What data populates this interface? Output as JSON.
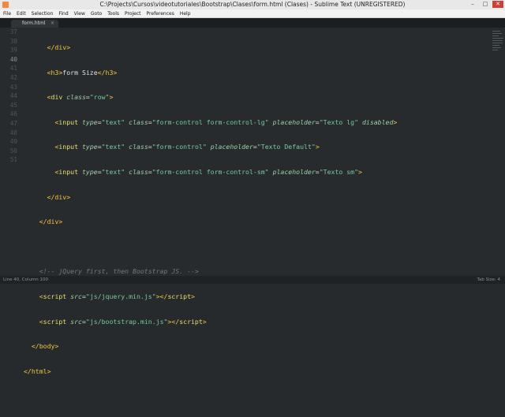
{
  "window": {
    "title": "C:\\Projects\\Cursos\\videotutoriales\\Bootstrap\\Clases\\form.html (Clases) - Sublime Text (UNREGISTERED)"
  },
  "menu": [
    "File",
    "Edit",
    "Selection",
    "Find",
    "View",
    "Goto",
    "Tools",
    "Project",
    "Preferences",
    "Help"
  ],
  "tab": {
    "label": "form.html",
    "close": "×"
  },
  "gutter": [
    "37",
    "38",
    "39",
    "40",
    "41",
    "42",
    "43",
    "44",
    "45",
    "46",
    "47",
    "48",
    "49",
    "50",
    "51"
  ],
  "code": {
    "l1_close_div": "</div>",
    "l2_h3_open": "<h3>",
    "l2_text": "form Size",
    "l2_h3_close": "</h3>",
    "l3_div": "div",
    "l3_class": "class",
    "l3_val": "\"row\"",
    "l4_input": "input",
    "l4_type": "type",
    "l4_text_val": "\"text\"",
    "l4_class": "class",
    "l4_class_val": "\"form-control form-control-lg\"",
    "l4_ph": "placeholder",
    "l4_ph_val": "\"Texto lg\"",
    "l4_disabled": "disabled",
    "l5_class_val": "\"form-control\"",
    "l5_ph_val": "\"Texto Default\"",
    "l6_class_val": "\"form-control form-control-sm\"",
    "l6_ph_val": "\"Texto sm\"",
    "l7_close_div": "</div>",
    "l8_close_div": "</div>",
    "l10_comment": "<!-- jQuery first, then Bootstrap JS. -->",
    "l11_src": "\"js/jquery.min.js\"",
    "l12_src": "\"js/bootstrap.min.js\"",
    "script": "script",
    "src": "src",
    "body_close": "</body>",
    "html_close": "</html>"
  },
  "status": {
    "left": "Line 40, Column 100",
    "right": "Tab Size: 4"
  }
}
